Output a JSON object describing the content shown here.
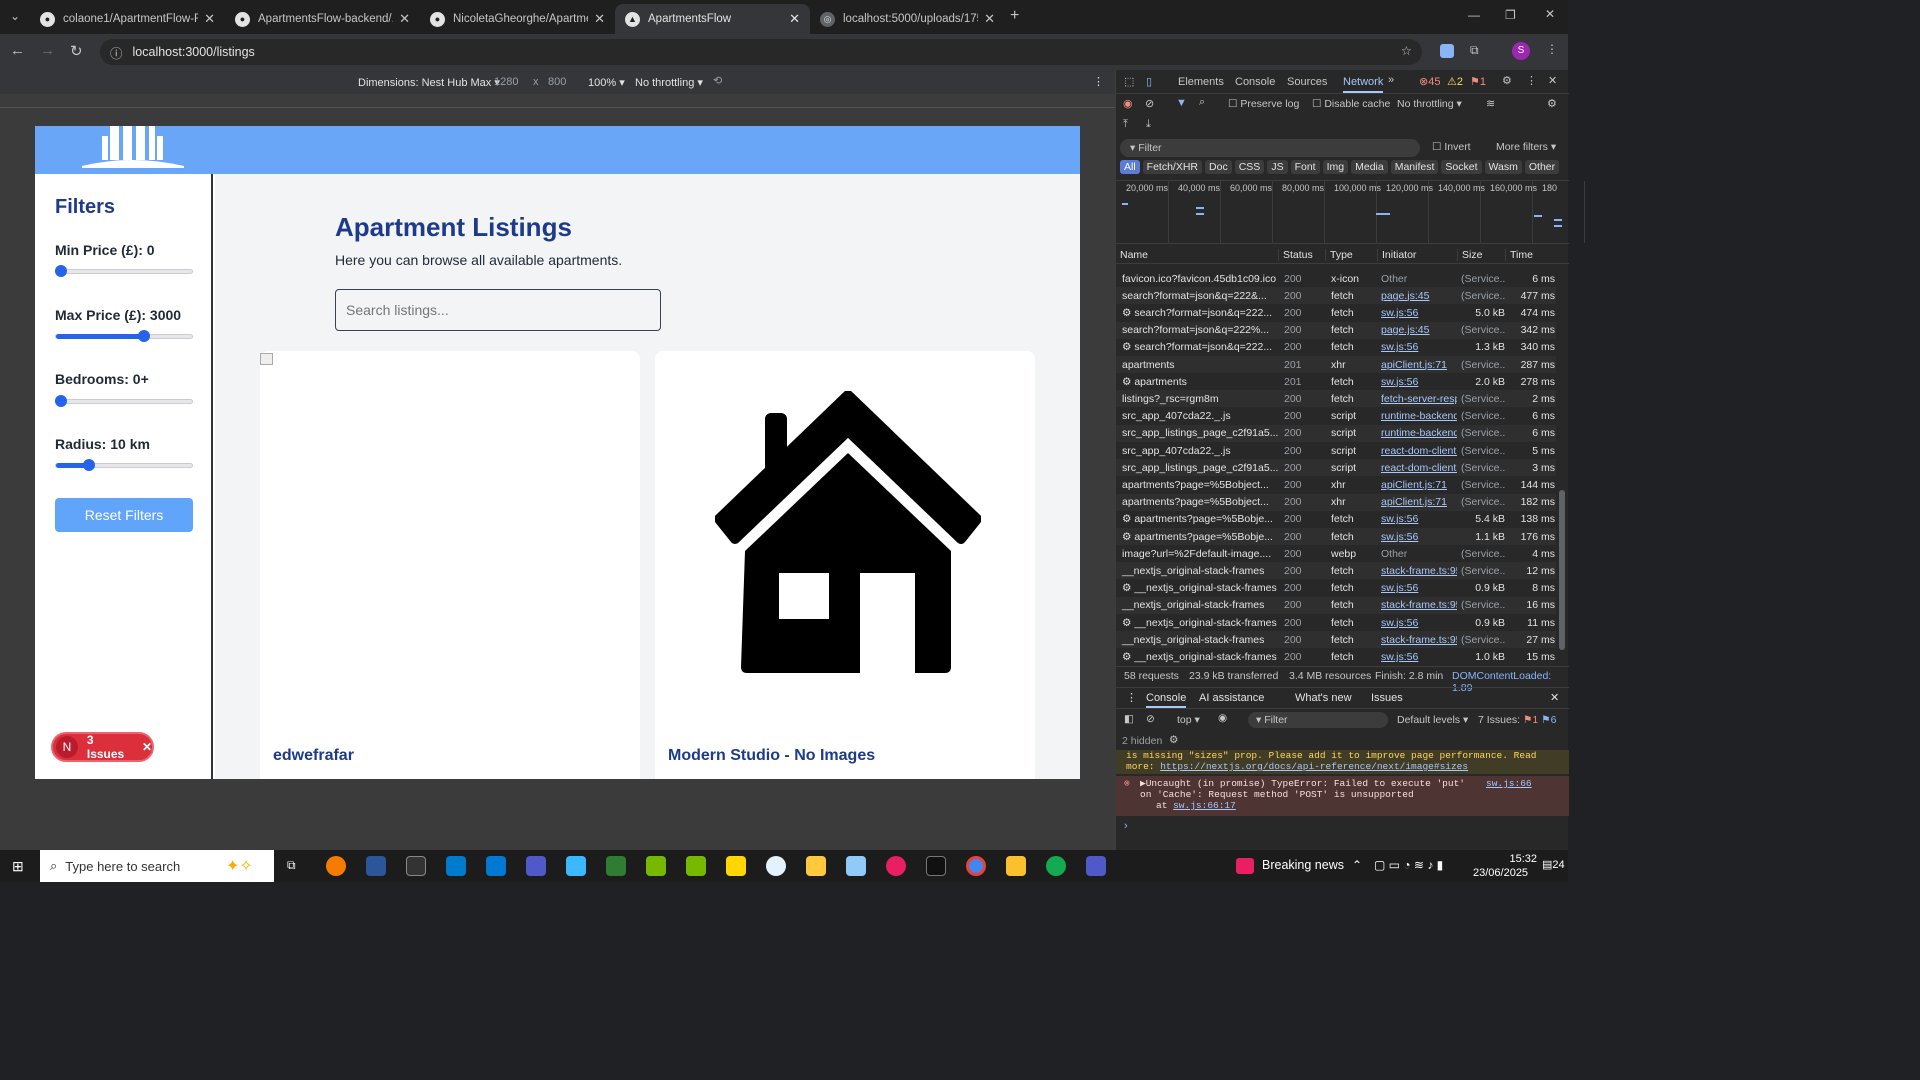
{
  "browser": {
    "tabs": [
      {
        "title": "colaone1/ApartmentFlow-Fullst",
        "icon": "github-icon"
      },
      {
        "title": "ApartmentsFlow-backend/.gitig",
        "icon": "github-icon"
      },
      {
        "title": "NicoletaGheorghe/ApartmentsF",
        "icon": "github-icon"
      },
      {
        "title": "ApartmentsFlow",
        "icon": "nextjs-icon"
      },
      {
        "title": "localhost:5000/uploads/175068",
        "icon": "globe-icon"
      }
    ],
    "url": "localhost:3000/listings"
  },
  "device_toolbar": {
    "dimensions": "Dimensions: Nest Hub Max",
    "width": "1280",
    "x": "x",
    "height": "800",
    "zoom": "100%",
    "throttling": "No throttling"
  },
  "site": {
    "filters_title": "Filters",
    "min_price": {
      "label": "Min Price (£): 0",
      "value_fraction": 0.0
    },
    "max_price": {
      "label": "Max Price (£): 3000",
      "value_fraction": 0.6
    },
    "bedrooms": {
      "label": "Bedrooms: 0+",
      "value_fraction": 0.0
    },
    "radius": {
      "label": "Radius: 10 km",
      "value_fraction": 0.2
    },
    "reset_label": "Reset Filters",
    "title": "Apartment Listings",
    "subtitle": "Here you can browse all available apartments.",
    "search_placeholder": "Search listings...",
    "listings": [
      {
        "title": "edwefrafar"
      },
      {
        "title": "Modern Studio - No Images"
      }
    ],
    "issues_badge": {
      "letter": "N",
      "text": "3 Issues"
    }
  },
  "devtools": {
    "tabs": [
      "Elements",
      "Console",
      "Sources",
      "Network"
    ],
    "errors": "45",
    "warnings": "2",
    "info": "1",
    "preserve_log": "Preserve log",
    "disable_cache": "Disable cache",
    "throttling": "No throttling",
    "filter_placeholder": "Filter",
    "invert": "Invert",
    "more_filters": "More filters",
    "type_filters": [
      "All",
      "Fetch/XHR",
      "Doc",
      "CSS",
      "JS",
      "Font",
      "Img",
      "Media",
      "Manifest",
      "Socket",
      "Wasm",
      "Other"
    ],
    "timeline_ticks": [
      "20,000 ms",
      "40,000 ms",
      "60,000 ms",
      "80,000 ms",
      "100,000 ms",
      "120,000 ms",
      "140,000 ms",
      "160,000 ms",
      "180"
    ],
    "columns": [
      "Name",
      "Status",
      "Type",
      "Initiator",
      "Size",
      "Time"
    ],
    "rows": [
      {
        "name": "favicon.ico?favicon.45db1c09.ico",
        "status": "200",
        "type": "x-icon",
        "initiator": "Other",
        "size": "(Service...",
        "time": "6 ms"
      },
      {
        "name": "search?format=json&q=222&...",
        "status": "200",
        "type": "fetch",
        "initiator": "page.js:45",
        "size": "(Service...",
        "time": "477 ms"
      },
      {
        "name": "⚙ search?format=json&q=222...",
        "status": "200",
        "type": "fetch",
        "initiator": "sw.js:56",
        "size": "5.0 kB",
        "time": "474 ms"
      },
      {
        "name": "search?format=json&q=222%...",
        "status": "200",
        "type": "fetch",
        "initiator": "page.js:45",
        "size": "(Service...",
        "time": "342 ms"
      },
      {
        "name": "⚙ search?format=json&q=222...",
        "status": "200",
        "type": "fetch",
        "initiator": "sw.js:56",
        "size": "1.3 kB",
        "time": "340 ms"
      },
      {
        "name": "apartments",
        "status": "201",
        "type": "xhr",
        "initiator": "apiClient.js:71",
        "size": "(Service...",
        "time": "287 ms"
      },
      {
        "name": "⚙ apartments",
        "status": "201",
        "type": "fetch",
        "initiator": "sw.js:56",
        "size": "2.0 kB",
        "time": "278 ms"
      },
      {
        "name": "listings?_rsc=rgm8m",
        "status": "200",
        "type": "fetch",
        "initiator": "fetch-server-respo",
        "size": "(Service...",
        "time": "2 ms"
      },
      {
        "name": "src_app_407cda22._.js",
        "status": "200",
        "type": "script",
        "initiator": "runtime-backend-",
        "size": "(Service...",
        "time": "6 ms"
      },
      {
        "name": "src_app_listings_page_c2f91a5...",
        "status": "200",
        "type": "script",
        "initiator": "runtime-backend-",
        "size": "(Service...",
        "time": "6 ms"
      },
      {
        "name": "src_app_407cda22._.js",
        "status": "200",
        "type": "script",
        "initiator": "react-dom-client.c",
        "size": "(Service...",
        "time": "5 ms"
      },
      {
        "name": "src_app_listings_page_c2f91a5...",
        "status": "200",
        "type": "script",
        "initiator": "react-dom-client.c",
        "size": "(Service...",
        "time": "3 ms"
      },
      {
        "name": "apartments?page=%5Bobject...",
        "status": "200",
        "type": "xhr",
        "initiator": "apiClient.js:71",
        "size": "(Service...",
        "time": "144 ms"
      },
      {
        "name": "apartments?page=%5Bobject...",
        "status": "200",
        "type": "xhr",
        "initiator": "apiClient.js:71",
        "size": "(Service...",
        "time": "182 ms"
      },
      {
        "name": "⚙ apartments?page=%5Bobje...",
        "status": "200",
        "type": "fetch",
        "initiator": "sw.js:56",
        "size": "5.4 kB",
        "time": "138 ms"
      },
      {
        "name": "⚙ apartments?page=%5Bobje...",
        "status": "200",
        "type": "fetch",
        "initiator": "sw.js:56",
        "size": "1.1 kB",
        "time": "176 ms"
      },
      {
        "name": "image?url=%2Fdefault-image....",
        "status": "200",
        "type": "webp",
        "initiator": "Other",
        "size": "(Service...",
        "time": "4 ms"
      },
      {
        "name": "__nextjs_original-stack-frames",
        "status": "200",
        "type": "fetch",
        "initiator": "stack-frame.ts:95",
        "size": "(Service...",
        "time": "12 ms"
      },
      {
        "name": "⚙ __nextjs_original-stack-frames",
        "status": "200",
        "type": "fetch",
        "initiator": "sw.js:56",
        "size": "0.9 kB",
        "time": "8 ms"
      },
      {
        "name": "__nextjs_original-stack-frames",
        "status": "200",
        "type": "fetch",
        "initiator": "stack-frame.ts:95",
        "size": "(Service...",
        "time": "16 ms"
      },
      {
        "name": "⚙ __nextjs_original-stack-frames",
        "status": "200",
        "type": "fetch",
        "initiator": "sw.js:56",
        "size": "0.9 kB",
        "time": "11 ms"
      },
      {
        "name": "__nextjs_original-stack-frames",
        "status": "200",
        "type": "fetch",
        "initiator": "stack-frame.ts:95",
        "size": "(Service...",
        "time": "27 ms"
      },
      {
        "name": "⚙ __nextjs_original-stack-frames",
        "status": "200",
        "type": "fetch",
        "initiator": "sw.js:56",
        "size": "1.0 kB",
        "time": "15 ms"
      }
    ],
    "summary": {
      "requests": "58 requests",
      "transferred": "23.9 kB transferred",
      "resources": "3.4 MB resources",
      "finish": "Finish: 2.8 min",
      "dcl": "DOMContentLoaded: 1.89"
    },
    "drawer_tabs": [
      "Console",
      "AI assistance",
      "What's new",
      "Issues"
    ],
    "console": {
      "context": "top",
      "filter": "Filter",
      "levels": "Default levels",
      "issues": "7 Issues:",
      "issue_err": "1",
      "issue_info": "6",
      "hidden": "2 hidden",
      "warn_text": "is missing \"sizes\" prop. Please add it to improve page performance. Read more:",
      "warn_link": "https://nextjs.org/docs/api-reference/next/image#sizes",
      "error_text": "▶Uncaught (in promise) TypeError: Failed to execute 'put' on 'Cache': Request method 'POST' is unsupported",
      "error_at": "at",
      "error_at_link": "sw.js:66:17",
      "error_link": "sw.js:66"
    }
  },
  "taskbar": {
    "search": "Type here to search",
    "news": "Breaking news",
    "time": "15:32",
    "date": "23/06/2025",
    "notifications": "24"
  }
}
